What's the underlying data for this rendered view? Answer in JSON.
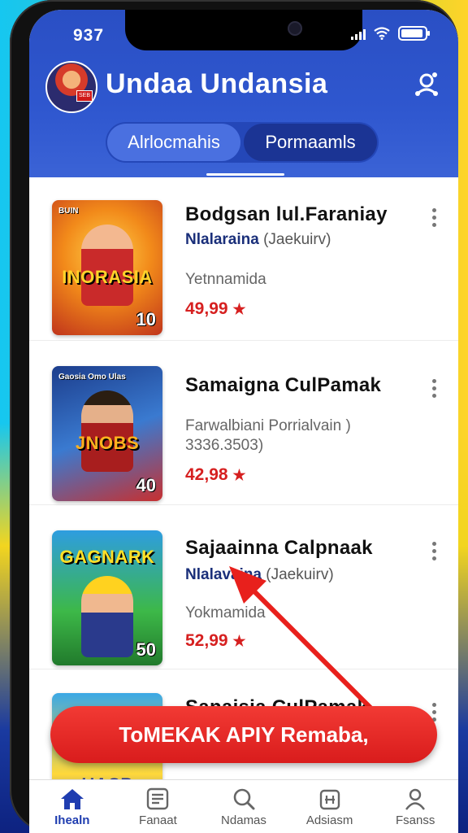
{
  "status_bar": {
    "time": "937"
  },
  "header": {
    "title": "Undaa Undansia",
    "avatar_badge": "SEB",
    "tabs": [
      {
        "label": "Alrlocmahis",
        "active": true
      },
      {
        "label": "Pormaamls",
        "active": false
      }
    ]
  },
  "games": [
    {
      "title": "Bodgsan lul.Faraniay",
      "publisher": "Nlalaraina",
      "publisher_suffix": "(Jaekuirv)",
      "meta_line1": "Yetnnamida",
      "meta_line2": "",
      "price": "49,99",
      "thumb_top": "BUIN",
      "thumb_logo": "INORASIA",
      "thumb_num": "10"
    },
    {
      "title": "Samaigna CulPamak",
      "publisher": "",
      "publisher_suffix": "",
      "meta_line1": "Farwalbiani Porrialvain )",
      "meta_line2": "3336.3503)",
      "price": "42,98",
      "thumb_top": "Gaosia Omo Ulas",
      "thumb_logo": "JNOBS",
      "thumb_num": "40"
    },
    {
      "title": "Sajaainna Calpnaak",
      "publisher": "Nlalavaina",
      "publisher_suffix": "(Jaekuirv)",
      "meta_line1": "Yokmamida",
      "meta_line2": "",
      "price": "52,99",
      "thumb_top": "",
      "thumb_logo": "GAGNARK",
      "thumb_num": "50"
    },
    {
      "title": "Sanaisia CulPamak",
      "thumb_logo": "UASP"
    }
  ],
  "cta": {
    "label": "ToMEKAK APIY Remaba,"
  },
  "bottom_nav": [
    {
      "label": "Ihealn",
      "icon": "home-icon",
      "active": true
    },
    {
      "label": "Fanaat",
      "icon": "list-icon",
      "active": false
    },
    {
      "label": "Ndamas",
      "icon": "search-icon",
      "active": false
    },
    {
      "label": "Adsiasm",
      "icon": "calendar-icon",
      "active": false
    },
    {
      "label": "Fsanss",
      "icon": "user-icon",
      "active": false
    }
  ],
  "colors": {
    "header_blue": "#2f57cf",
    "price_red": "#d62020",
    "cta_red": "#e62626",
    "nav_active": "#1f3db0"
  }
}
